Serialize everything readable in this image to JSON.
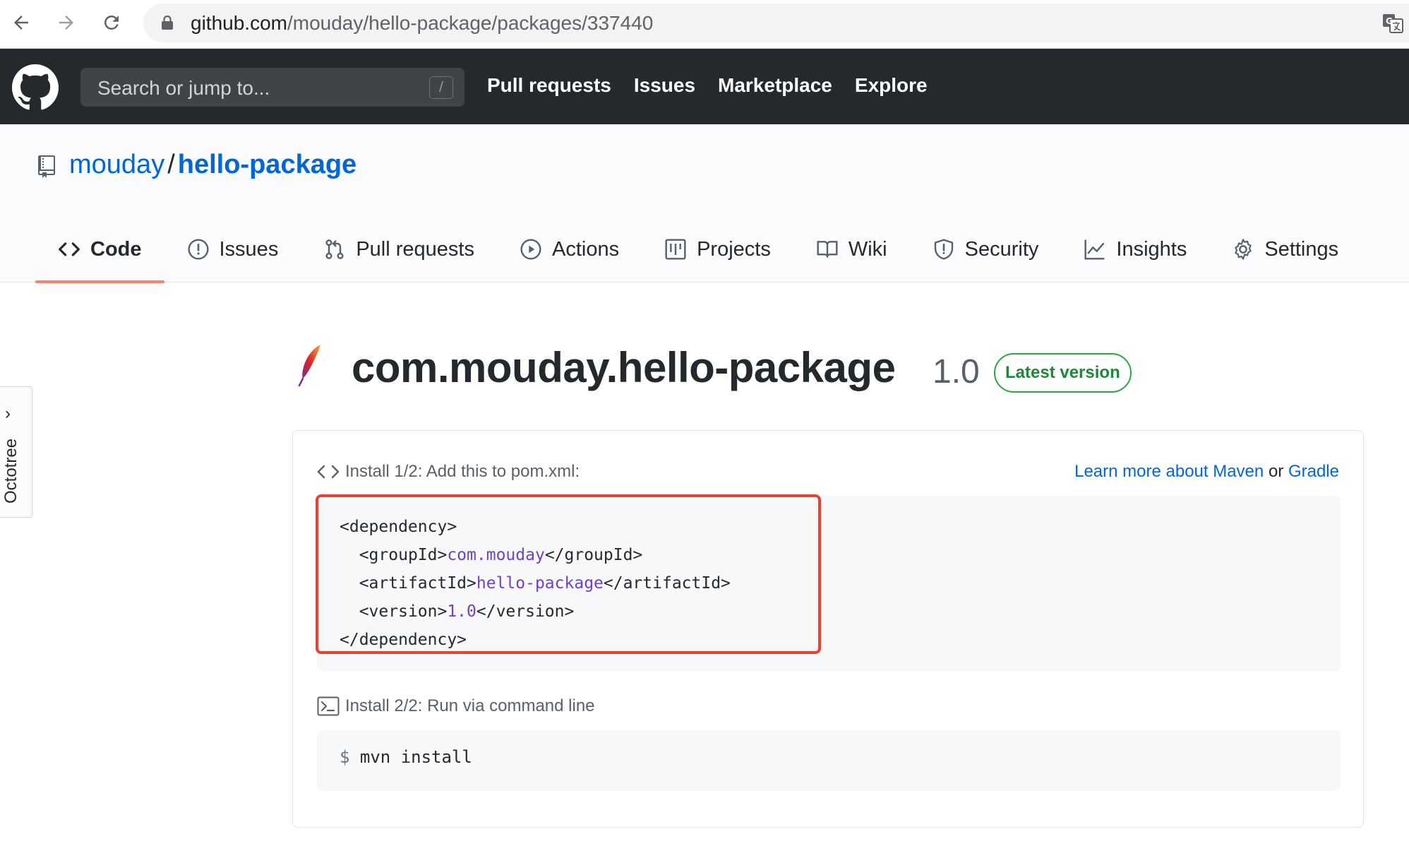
{
  "browser": {
    "url_host": "github.com",
    "url_path": "/mouday/hello-package/packages/337440"
  },
  "header": {
    "search_placeholder": "Search or jump to...",
    "search_key": "/",
    "nav": [
      "Pull requests",
      "Issues",
      "Marketplace",
      "Explore"
    ]
  },
  "repo": {
    "owner": "mouday",
    "separator": "/",
    "name": "hello-package",
    "tabs": [
      {
        "label": "Code",
        "icon": "code-icon",
        "active": true
      },
      {
        "label": "Issues",
        "icon": "issue-icon"
      },
      {
        "label": "Pull requests",
        "icon": "pull-request-icon"
      },
      {
        "label": "Actions",
        "icon": "play-icon"
      },
      {
        "label": "Projects",
        "icon": "project-icon"
      },
      {
        "label": "Wiki",
        "icon": "book-icon"
      },
      {
        "label": "Security",
        "icon": "shield-icon"
      },
      {
        "label": "Insights",
        "icon": "graph-icon"
      },
      {
        "label": "Settings",
        "icon": "gear-icon"
      }
    ]
  },
  "sidebar": {
    "octotree_label": "Octotree"
  },
  "package": {
    "name": "com.mouday.hello-package",
    "version": "1.0",
    "badge": "Latest version"
  },
  "install": {
    "step1_label": "Install 1/2: Add this to pom.xml:",
    "learn_prefix": "Learn more about Maven",
    "learn_or": "or",
    "learn_gradle": "Gradle",
    "pom": {
      "open_dep": "<dependency>",
      "group_open": "<groupId>",
      "group_val": "com.mouday",
      "group_close": "</groupId>",
      "artifact_open": "<artifactId>",
      "artifact_val": "hello-package",
      "artifact_close": "</artifactId>",
      "version_open": "<version>",
      "version_val": "1.0",
      "version_close": "</version>",
      "close_dep": "</dependency>"
    },
    "step2_label": "Install 2/2: Run via command line",
    "prompt": "$",
    "command": "mvn install"
  },
  "colors": {
    "header_bg": "#24292e",
    "link": "#0366d6",
    "active_tab_underline": "#f9826c",
    "badge_green": "#28a745",
    "highlight_red": "#e8412f",
    "code_value": "#6f42c1"
  }
}
